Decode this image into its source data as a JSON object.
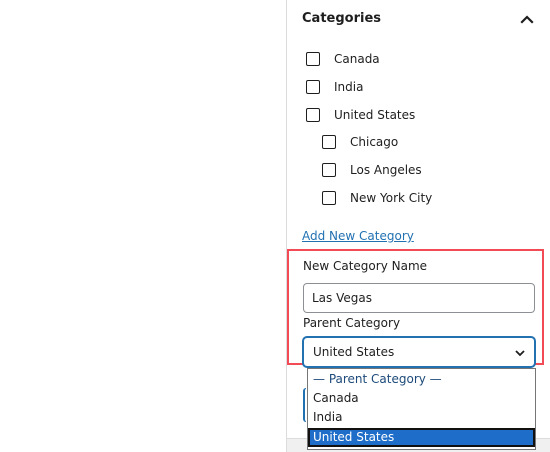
{
  "panel": {
    "title": "Categories"
  },
  "categories": [
    {
      "label": "Canada",
      "checked": false
    },
    {
      "label": "India",
      "checked": false
    },
    {
      "label": "United States",
      "checked": false
    },
    {
      "label": "Chicago",
      "checked": false
    },
    {
      "label": "Los Angeles",
      "checked": false
    },
    {
      "label": "New York City",
      "checked": false
    }
  ],
  "add_new": {
    "link_label": "Add New Category",
    "name_label": "New Category Name",
    "name_value": "Las Vegas",
    "parent_label": "Parent Category",
    "parent_selected": "United States",
    "options": [
      "— Parent Category —",
      "Canada",
      "India",
      "United States"
    ]
  },
  "colors": {
    "link": "#2271b1",
    "highlight_border": "#f24b55",
    "selected_option_bg": "#1e6ec9"
  }
}
